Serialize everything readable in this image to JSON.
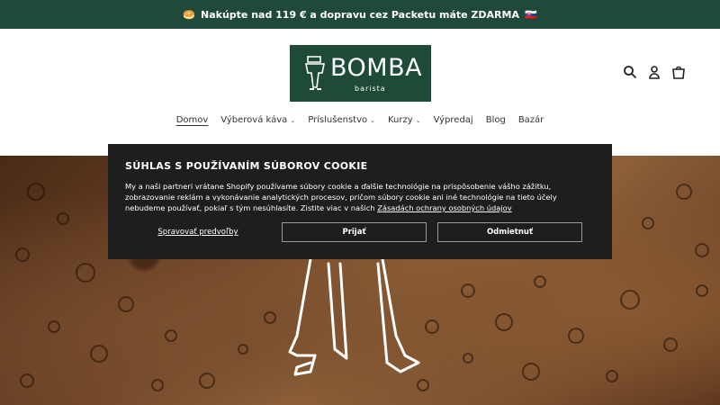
{
  "announcement": {
    "emoji_left": "🥯",
    "text": "Nakúpte nad 119 € a dopravu cez Packetu máte ZDARMA",
    "emoji_right": "🇸🇰"
  },
  "brand": {
    "name": "BOMBA",
    "subtitle": "barista"
  },
  "nav": {
    "items": [
      {
        "label": "Domov",
        "chevron": "",
        "active": true
      },
      {
        "label": "Výberová káva",
        "chevron": "⌄"
      },
      {
        "label": "Príslušenstvo",
        "chevron": "⌄"
      },
      {
        "label": "Kurzy",
        "chevron": "⌄"
      },
      {
        "label": "Výpredaj",
        "chevron": ""
      },
      {
        "label": "Blog",
        "chevron": ""
      },
      {
        "label": "Bazár",
        "chevron": ""
      }
    ]
  },
  "icons": {
    "search": "search-icon",
    "account": "account-icon",
    "cart": "cart-icon"
  },
  "cookie": {
    "title": "SÚHLAS S POUŽÍVANÍM SÚBOROV COOKIE",
    "body": "My a naši partneri vrátane Shopify používame súbory cookie a ďalšie technológie na prispôsobenie vášho zážitku, zobrazovanie reklám a vykonávanie analytických procesov, pričom súbory cookie ani iné technológie na tieto účely nebudeme používať, pokiaľ s tým nesúhlasíte. Zistite viac v našich ",
    "policy_link": "Zásadách ochrany osobných údajov",
    "manage_label": "Spravovať predvoľby",
    "accept_label": "Prijať",
    "decline_label": "Odmietnuť"
  },
  "colors": {
    "announcement_bg": "#1f4a39",
    "logo_bg": "#1e4a38",
    "cookie_bg": "#1e1e1e"
  }
}
